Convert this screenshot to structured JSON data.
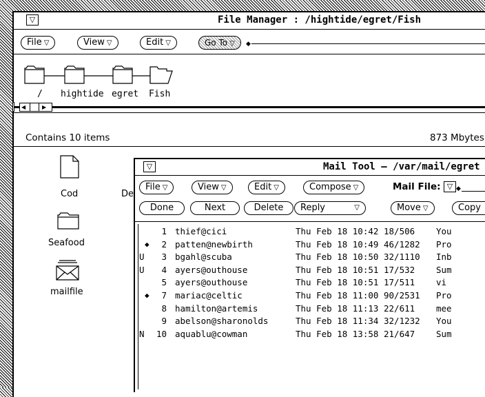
{
  "file_manager": {
    "title": "File Manager : /hightide/egret/Fish",
    "menu_buttons": {
      "file": "File",
      "view": "View",
      "edit": "Edit",
      "goto": "Go To"
    },
    "path": [
      "/",
      "hightide",
      "egret",
      "Fish"
    ],
    "status": "Contains 10 items",
    "disk_free": "873 Mbytes",
    "items": [
      {
        "name": "Cod",
        "icon": "document-icon"
      },
      {
        "name": "Seafood",
        "icon": "folder-icon"
      },
      {
        "name": "mailfile",
        "icon": "envelope-icon"
      }
    ],
    "partial_label": "De"
  },
  "mail_tool": {
    "title": "Mail Tool  – /var/mail/egret",
    "menu_buttons": {
      "file": "File",
      "view": "View",
      "edit": "Edit",
      "compose": "Compose"
    },
    "mail_file_label": "Mail File:",
    "action_buttons": {
      "done": "Done",
      "next": "Next",
      "delete": "Delete",
      "reply": "Reply",
      "move": "Move",
      "copy": "Copy"
    },
    "messages": [
      {
        "flag": "",
        "marker": "",
        "num": "1",
        "sender": "thief@cici",
        "date": "Thu Feb 18 10:42",
        "size": "18/506",
        "subject": "You"
      },
      {
        "flag": "",
        "marker": "◆",
        "num": "2",
        "sender": "patten@newbirth",
        "date": "Thu Feb 18 10:49",
        "size": "46/1282",
        "subject": "Pro"
      },
      {
        "flag": "U",
        "marker": "",
        "num": "3",
        "sender": "bgahl@scuba",
        "date": "Thu Feb 18 10:50",
        "size": "32/1110",
        "subject": "Inb"
      },
      {
        "flag": "U",
        "marker": "",
        "num": "4",
        "sender": "ayers@outhouse",
        "date": "Thu Feb 18 10:51",
        "size": "17/532",
        "subject": "Sum"
      },
      {
        "flag": "",
        "marker": "",
        "num": "5",
        "sender": "ayers@outhouse",
        "date": "Thu Feb 18 10:51",
        "size": "17/511",
        "subject": "vi"
      },
      {
        "flag": "",
        "marker": "◆",
        "num": "7",
        "sender": "mariac@celtic",
        "date": "Thu Feb 18 11:00",
        "size": "90/2531",
        "subject": "Pro"
      },
      {
        "flag": "",
        "marker": "",
        "num": "8",
        "sender": "hamilton@artemis",
        "date": "Thu Feb 18 11:13",
        "size": "22/611",
        "subject": "mee"
      },
      {
        "flag": "",
        "marker": "",
        "num": "9",
        "sender": "abelson@sharonolds",
        "date": "Thu Feb 18 11:34",
        "size": "32/1232",
        "subject": "You"
      },
      {
        "flag": "N",
        "marker": "",
        "num": "10",
        "sender": "aquablu@cowman",
        "date": "Thu Feb 18 13:58",
        "size": "21/647",
        "subject": "Sum"
      }
    ]
  }
}
